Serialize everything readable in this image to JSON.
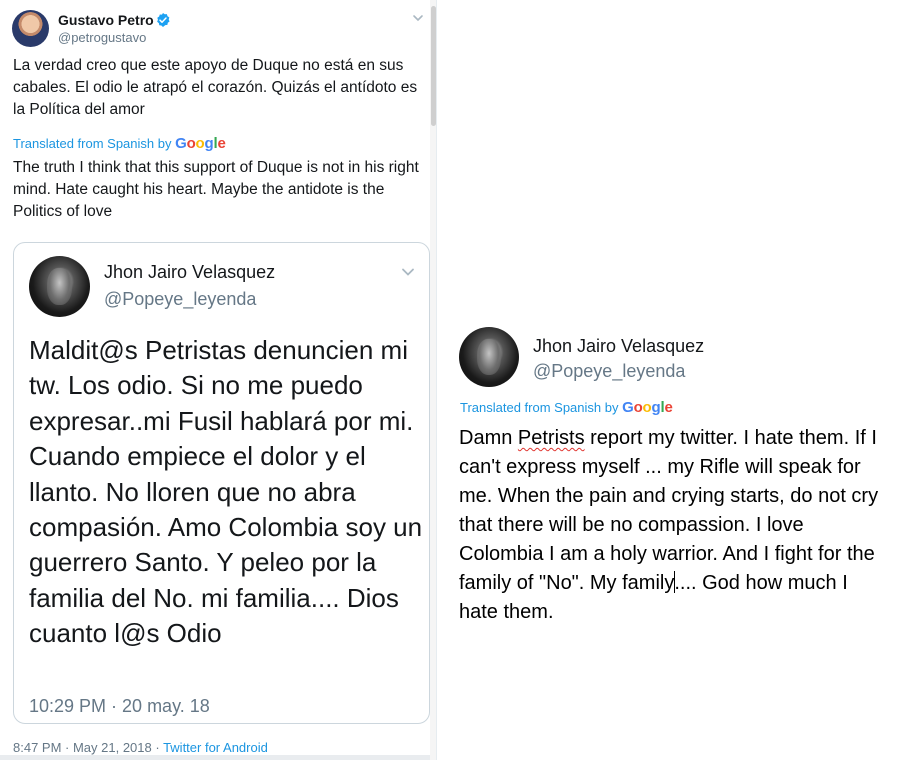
{
  "left_tweet": {
    "author_name": "Gustavo Petro",
    "author_handle": "@petrogustavo",
    "text": "La verdad creo que este apoyo de Duque no está en sus cabales. El odio le atrapó el corazón. Quizás el antídoto es la Política del amor",
    "translated_label": "Translated from Spanish by",
    "google_logo": [
      "G",
      "o",
      "o",
      "g",
      "l",
      "e"
    ],
    "translation": "The truth I think that this support of Duque is not in his right mind. Hate caught his heart. Maybe the antidote is the Politics of love",
    "meta_time": "8:47 PM · May 21, 2018 · ",
    "meta_source": "Twitter for Android"
  },
  "quoted_tweet": {
    "author_name": "Jhon Jairo Velasquez",
    "author_handle": "@Popeye_leyenda",
    "text": "Maldit@s Petristas denuncien mi tw.  Los odio. Si no me puedo expresar..mi Fusil hablará por mi. Cuando empiece el dolor y el llanto. No lloren que no abra compasión. Amo Colombia soy un guerrero Santo. Y peleo por la familia del No. mi familia.... Dios cuanto l@s Odio",
    "date": "10:29 PM · 20 may. 18"
  },
  "right_panel": {
    "author_name": "Jhon Jairo Velasquez",
    "author_handle": "@Popeye_leyenda",
    "translated_label": "Translated from Spanish by",
    "google_logo": [
      "G",
      "o",
      "o",
      "g",
      "l",
      "e"
    ],
    "translation_part1": "Damn ",
    "translation_misspelled": "Petrists",
    "translation_part2": " report my twitter. I hate them. If I can't express myself ... my Rifle will speak for me. When the pain and crying starts, do not cry that there will be no compassion. I love Colombia I am a holy warrior. And I fight for the family of \"No\". My family",
    "translation_part3": ".... God how much I hate them."
  },
  "colors": {
    "link_blue": "#1b95e0",
    "secondary_text": "#657786",
    "verified_blue": "#1da1f2",
    "card_border": "#ccd6dd"
  },
  "icons": [
    "verified-badge-icon",
    "chevron-down-icon"
  ]
}
